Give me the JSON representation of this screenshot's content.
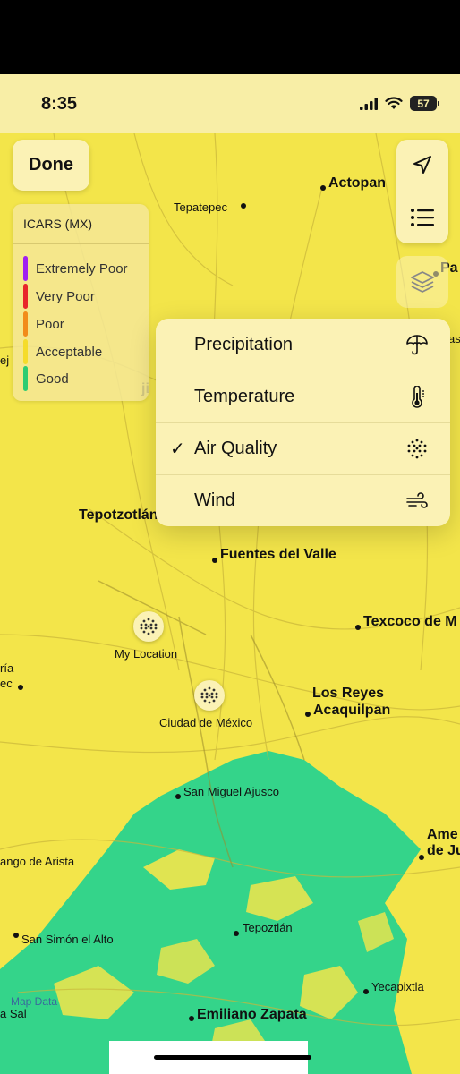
{
  "status_bar": {
    "time": "8:35",
    "battery": "57"
  },
  "buttons": {
    "done": "Done"
  },
  "legend": {
    "title": "ICARS (MX)",
    "items": [
      {
        "label": "Extremely Poor",
        "color": "#a020f0"
      },
      {
        "label": "Very Poor",
        "color": "#e8262a"
      },
      {
        "label": "Poor",
        "color": "#f28c1a"
      },
      {
        "label": "Acceptable",
        "color": "#f5dc2a"
      },
      {
        "label": "Good",
        "color": "#2ecc71"
      }
    ]
  },
  "layer_menu": {
    "items": [
      {
        "label": "Precipitation",
        "icon": "umbrella-icon",
        "checked": false
      },
      {
        "label": "Temperature",
        "icon": "thermometer-icon",
        "checked": false
      },
      {
        "label": "Air Quality",
        "icon": "air-quality-icon",
        "checked": true
      },
      {
        "label": "Wind",
        "icon": "wind-icon",
        "checked": false
      }
    ],
    "check": "✓"
  },
  "map_labels": {
    "actopan": "Actopan",
    "tepatepec": "Tepatepec",
    "pa": "Pa",
    "as": "as",
    "ej": "ej",
    "ji": "ji",
    "tepotzotlan": "Tepotzotlán",
    "fuentes": "Fuentes del Valle",
    "texcoco": "Texcoco de M",
    "my_location": "My Location",
    "ria": "ría",
    "ec": "ec",
    "los_reyes_1": "Los Reyes",
    "los_reyes_2": "Acaquilpan",
    "cdmx": "Ciudad de México",
    "ajusco": "San Miguel Ajusco",
    "ame_1": "Ame",
    "ame_2": "de Ju",
    "arista": "ango de Arista",
    "simon": "San Simón el Alto",
    "tepoztlan": "Tepoztlán",
    "yecapixtla": "Yecapixtla",
    "a_sal": "a Sal",
    "zapata": "Emiliano Zapata",
    "map_data": "Map Data"
  },
  "colors": {
    "map_yellow": "#f3e54a",
    "map_green": "#34d48a",
    "panel": "#fbf2b5"
  }
}
